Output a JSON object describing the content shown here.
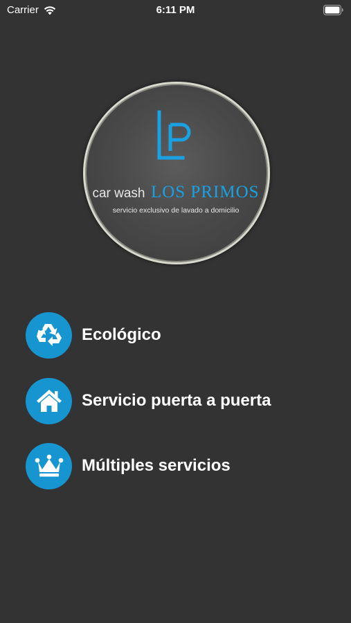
{
  "status_bar": {
    "carrier": "Carrier",
    "time": "6:11 PM",
    "icons": [
      "wifi-icon",
      "battery-icon"
    ]
  },
  "logo": {
    "monogram": "LP",
    "prefix": "car wash",
    "name": "LOS PRIMOS",
    "tagline": "servicio exclusivo de lavado a domicilio",
    "accent_color": "#1aa1e3"
  },
  "features": [
    {
      "label": "Ecológico",
      "icon": "recycle-icon"
    },
    {
      "label": "Servicio puerta a puerta",
      "icon": "house-icon"
    },
    {
      "label": "Múltiples servicios",
      "icon": "crown-icon"
    }
  ],
  "colors": {
    "background": "#333333",
    "badge": "#1695d0",
    "text": "#ffffff"
  }
}
